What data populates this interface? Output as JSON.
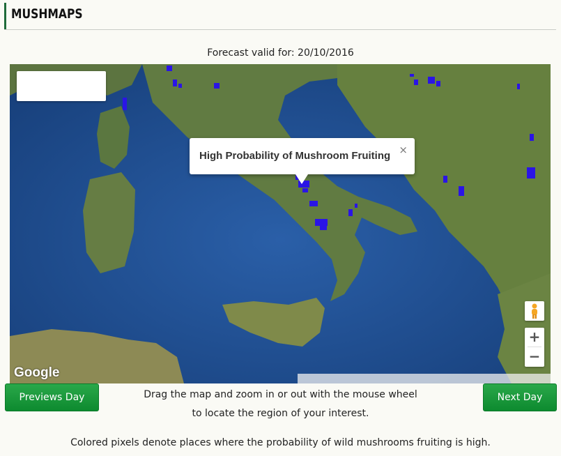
{
  "brand": {
    "title": "MUSHMAPS"
  },
  "forecast": {
    "label": "Forecast valid for: 20/10/2016"
  },
  "map": {
    "popup_title": "High Probability of Mushroom Fruiting",
    "popup_close": "×",
    "zoom_in": "+",
    "zoom_out": "−",
    "logo": "Google",
    "colors": {
      "sea": "#1d4f92",
      "land": "#5f7a3f",
      "marker": "#2a14e6"
    }
  },
  "controls": {
    "prev_label": "Previews Day",
    "next_label": "Next Day",
    "hint_line1": "Drag the map and zoom in or out with the mouse wheel",
    "hint_line2": "to locate the region of your interest."
  },
  "footnote": "Colored pixels denote places where the probability of wild mushrooms fruiting is high."
}
